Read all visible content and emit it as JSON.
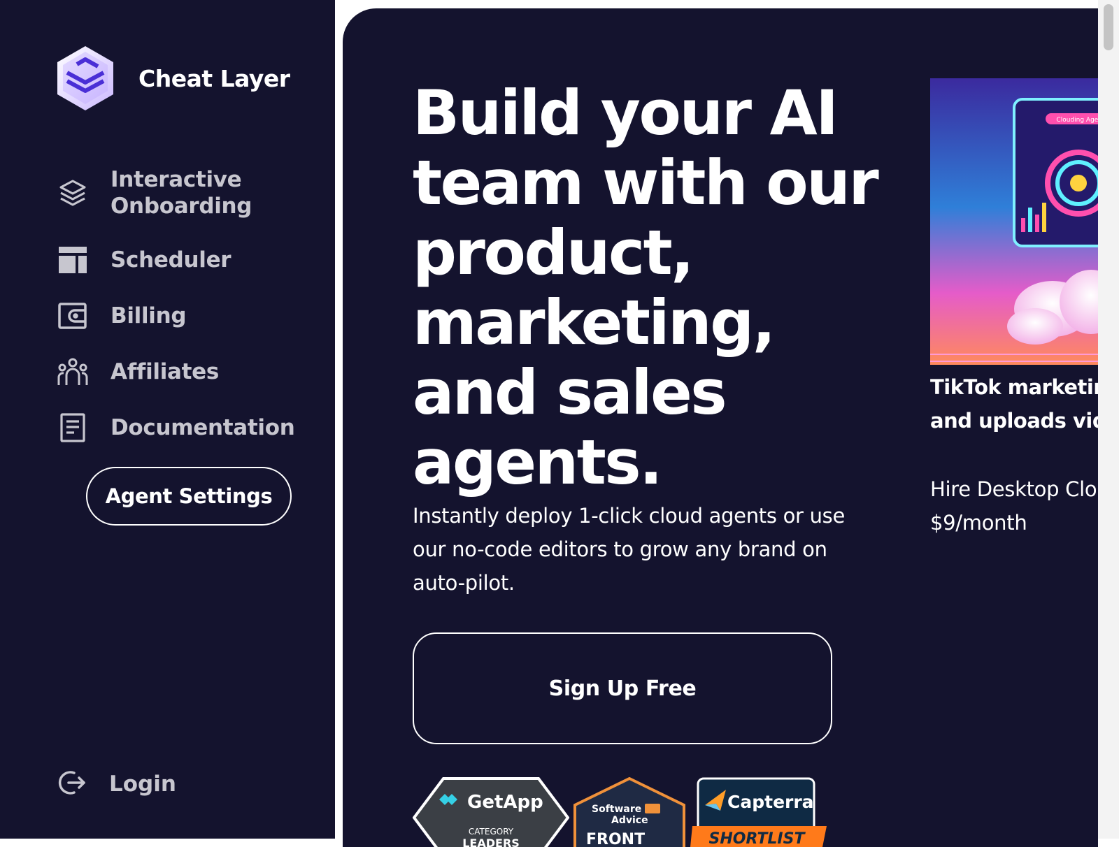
{
  "brand": {
    "name": "Cheat Layer",
    "logo_icon": "layers-hexagon-logo"
  },
  "sidebar": {
    "items": [
      {
        "label": "Interactive Onboarding",
        "icon": "stack-icon"
      },
      {
        "label": "Scheduler",
        "icon": "layout-icon"
      },
      {
        "label": "Billing",
        "icon": "wallet-icon"
      },
      {
        "label": "Affiliates",
        "icon": "users-icon"
      },
      {
        "label": "Documentation",
        "icon": "document-icon"
      }
    ],
    "agent_settings_label": "Agent Settings",
    "login_label": "Login",
    "colors": {
      "background": "#14132e",
      "nav_text": "#c7c6cf"
    }
  },
  "hero": {
    "title": "Build your AI team with our product, marketing, and sales agents.",
    "subtitle": "Instantly deploy 1-click cloud agents or use our no-code editors to grow any brand on auto-pilot.",
    "signup_label": "Sign Up Free"
  },
  "badges": {
    "getapp": {
      "brand": "GetApp",
      "line1": "CATEGORY",
      "line2": "LEADERS"
    },
    "software_advice": {
      "brand_line1": "Software",
      "brand_line2": "Advice",
      "line": "FRONT"
    },
    "capterra": {
      "brand": "Capterra",
      "line": "SHORTLIST"
    }
  },
  "card": {
    "image_label": "Clouding Agent",
    "title_line1": "TikTok marketin",
    "title_line2": "and uploads vid",
    "desc_line1": "Hire Desktop Clo",
    "desc_line2": "$9/month"
  }
}
